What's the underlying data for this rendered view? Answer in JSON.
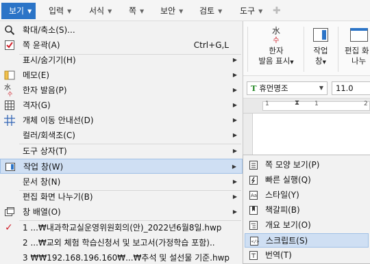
{
  "menubar": {
    "items": [
      {
        "label": "보기",
        "active": true
      },
      {
        "label": "입력"
      },
      {
        "label": "서식"
      },
      {
        "label": "쪽"
      },
      {
        "label": "보안"
      },
      {
        "label": "검토"
      },
      {
        "label": "도구"
      }
    ]
  },
  "ribbon": {
    "hanja_btn": {
      "line1": "한자",
      "line2": "발음 표시"
    },
    "work_btn": {
      "line1": "작업",
      "line2": "창"
    },
    "split_btn": {
      "line1": "편집 화",
      "line2": "나누"
    },
    "font_name": "휴먼명조",
    "font_size": "11.0",
    "ruler_marks": [
      "1",
      "1",
      "2"
    ]
  },
  "view_menu": {
    "items": [
      {
        "label": "확대/축소(S)...",
        "icon": "magnifier-icon"
      },
      {
        "label": "쪽 윤곽(A)",
        "shortcut": "Ctrl+G,L",
        "icon": "checkbox-checked-icon"
      },
      {
        "label": "표시/숨기기(H)",
        "submenu": true
      },
      {
        "label": "메모(E)",
        "submenu": true,
        "icon": "memo-icon"
      },
      {
        "label": "한자 발음(P)",
        "submenu": true,
        "icon": "hanja-icon"
      },
      {
        "label": "격자(G)",
        "submenu": true,
        "icon": "grid-icon"
      },
      {
        "label": "개체 이동 안내선(D)",
        "submenu": true,
        "icon": "guide-grid-icon"
      },
      {
        "label": "컬러/회색조(C)",
        "submenu": true
      },
      {
        "label": "도구 상자(T)",
        "submenu": true
      },
      {
        "label": "작업 창(W)",
        "submenu": true,
        "highlighted": true,
        "icon": "task-pane-icon"
      },
      {
        "label": "문서 창(N)",
        "submenu": true
      },
      {
        "label": "편집 화면 나누기(B)",
        "submenu": true
      },
      {
        "label": "창 배열(O)",
        "submenu": true,
        "icon": "window-arrange-icon"
      },
      {
        "label": "1 ...₩내과학교실운영위원회의(안)_2022년6월8일.hwp",
        "icon": "checkmark-icon"
      },
      {
        "label": "2 ...₩교외 체험 학습신청서 및 보고서(가정학습 포함).."
      },
      {
        "label": "3 ₩₩192.168.196.160₩...₩추석 및 설선물 기준.hwp"
      }
    ]
  },
  "task_pane_submenu": {
    "items": [
      {
        "label": "쪽 모양 보기(P)",
        "icon": "page-view-icon"
      },
      {
        "label": "빠른 실행(Q)",
        "icon": "quick-run-icon"
      },
      {
        "label": "스타일(Y)",
        "icon": "style-icon"
      },
      {
        "label": "책갈피(B)",
        "icon": "bookmark-icon"
      },
      {
        "label": "개요 보기(O)",
        "icon": "outline-icon"
      },
      {
        "label": "스크립트(S)",
        "icon": "script-icon",
        "highlighted": true
      },
      {
        "label": "번역(T)",
        "icon": "translate-icon"
      }
    ]
  },
  "colors": {
    "accent": "#2b74c7",
    "highlight": "#cfdff3",
    "highlight_border": "#9fc0e6",
    "check_red": "#d0202a"
  }
}
